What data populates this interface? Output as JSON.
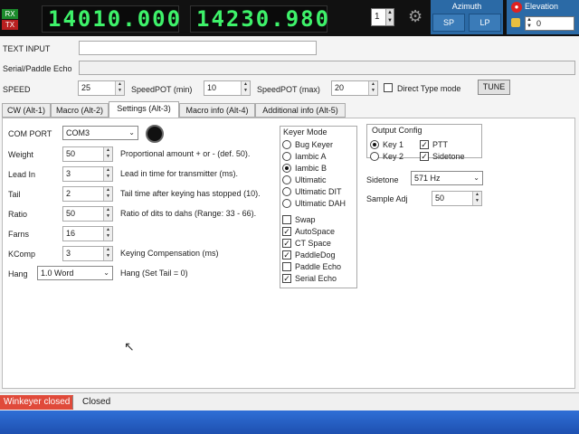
{
  "topbar": {
    "rx": "RX",
    "tx": "TX",
    "freq_a": "14010.000",
    "freq_b": "14230.980",
    "vfo_value": "1",
    "azimuth_title": "Azimuth",
    "sp": "SP",
    "lp": "LP",
    "elevation_title": "Elevation",
    "elevation_value": "0"
  },
  "main": {
    "text_input_label": "TEXT INPUT",
    "serial_echo_label": "Serial/Paddle Echo",
    "speed_label": "SPEED",
    "speed_value": "25",
    "speedpot_min_label": "SpeedPOT (min)",
    "speedpot_min_value": "10",
    "speedpot_max_label": "SpeedPOT (max)",
    "speedpot_max_value": "20",
    "direct_type_label": "Direct Type mode",
    "tune_label": "TUNE"
  },
  "tabs": [
    {
      "label": "CW (Alt-1)"
    },
    {
      "label": "Macro (Alt-2)"
    },
    {
      "label": "Settings (Alt-3)"
    },
    {
      "label": "Macro info (Alt-4)"
    },
    {
      "label": "Additional info (Alt-5)"
    }
  ],
  "settings": {
    "com_port_label": "COM PORT",
    "com_port_value": "COM3",
    "weight_label": "Weight",
    "weight_value": "50",
    "weight_desc": "Proportional amount + or - (def. 50).",
    "leadin_label": "Lead In",
    "leadin_value": "3",
    "leadin_desc": "Lead in time for transmitter (ms).",
    "tail_label": "Tail",
    "tail_value": "2",
    "tail_desc": "Tail time after keying has stopped (10).",
    "ratio_label": "Ratio",
    "ratio_value": "50",
    "ratio_desc": "Ratio of dits to dahs (Range: 33 - 66).",
    "farns_label": "Farns",
    "farns_value": "16",
    "kcomp_label": "KComp",
    "kcomp_value": "3",
    "kcomp_desc": "Keying Compensation (ms)",
    "hang_label": "Hang",
    "hang_value": "1.0 Word",
    "hang_desc": "Hang (Set Tail = 0)"
  },
  "keyer": {
    "title": "Keyer Mode",
    "modes": [
      "Bug Keyer",
      "Iambic A",
      "Iambic B",
      "Ultimatic",
      "Ultimatic DIT",
      "Ultimatic DAH"
    ],
    "options": [
      "Swap",
      "AutoSpace",
      "CT Space",
      "PaddleDog",
      "Paddle Echo",
      "Serial Echo"
    ]
  },
  "output": {
    "title": "Output Config",
    "key1": "Key 1",
    "key2": "Key 2",
    "ptt": "PTT",
    "sidetone": "Sidetone",
    "sidetone_label": "Sidetone",
    "sidetone_value": "571 Hz",
    "sample_adj_label": "Sample Adj",
    "sample_adj_value": "50"
  },
  "status": {
    "winkeyer": "Winkeyer closed",
    "closed": "Closed"
  }
}
